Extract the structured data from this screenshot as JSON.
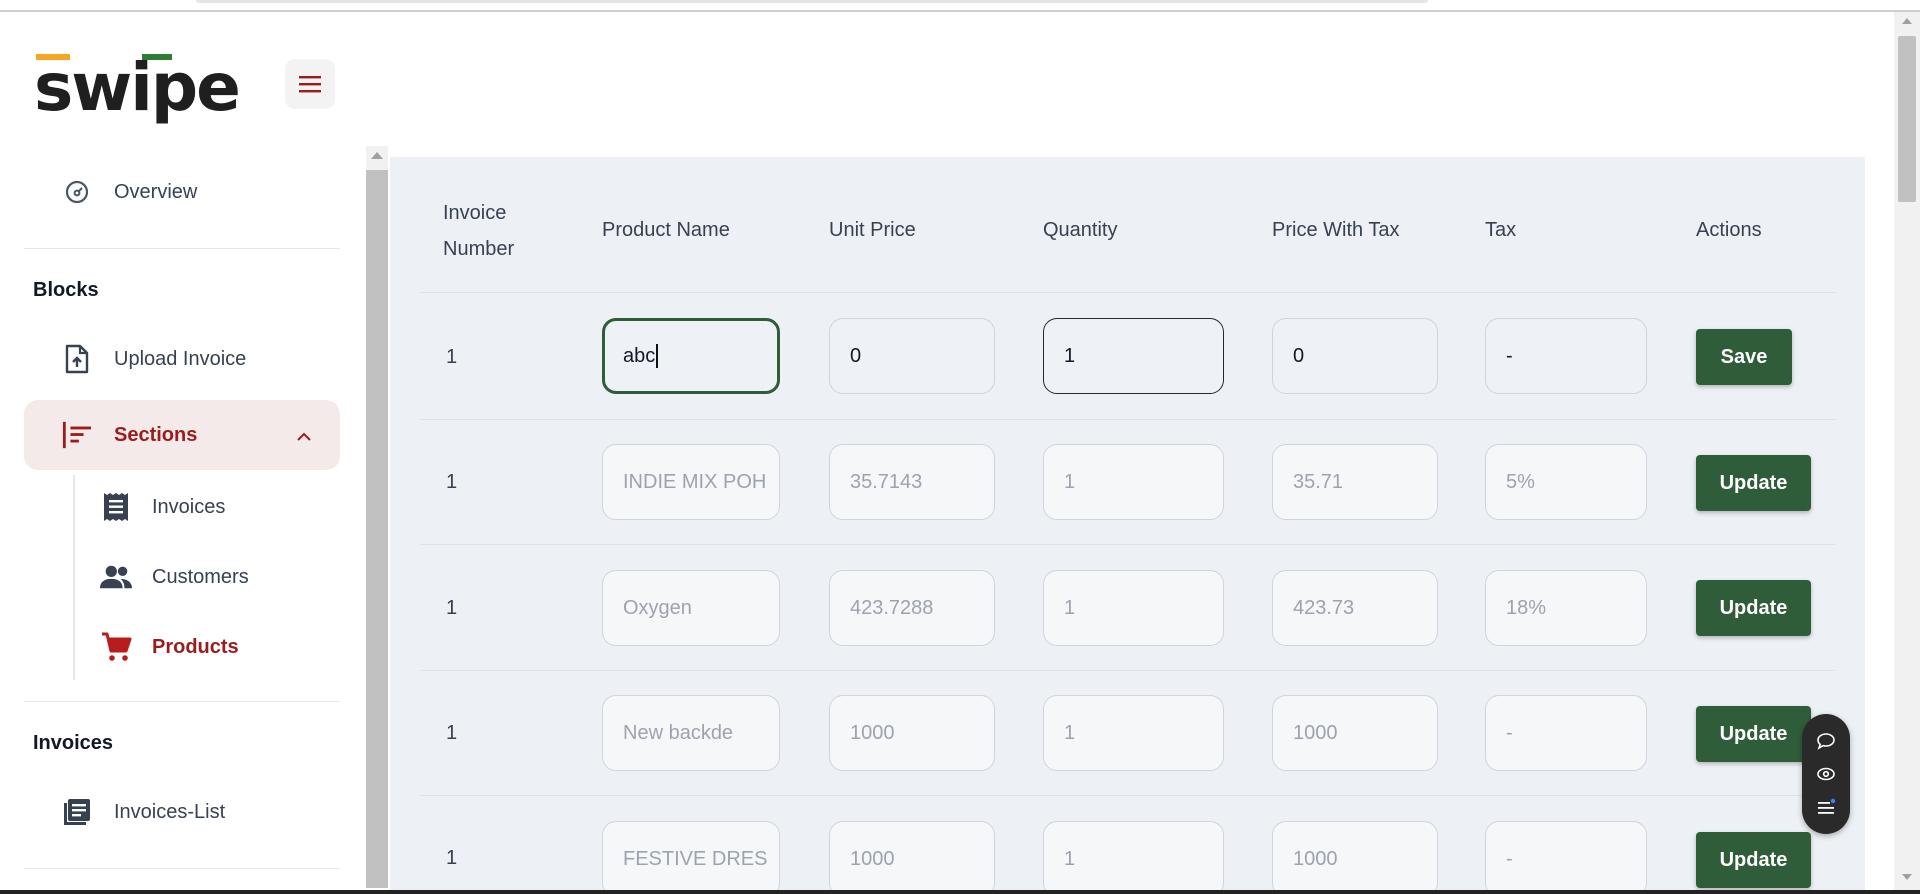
{
  "brand": {
    "logo_text": "swipe",
    "accent_orange": "#f5a623",
    "accent_green": "#2e7d32"
  },
  "sidebar": {
    "overview": "Overview",
    "blocks_heading": "Blocks",
    "upload_invoice": "Upload Invoice",
    "sections": "Sections",
    "sub_items": [
      "Invoices",
      "Customers",
      "Products"
    ],
    "invoices_heading": "Invoices",
    "invoices_list": "Invoices-List"
  },
  "table": {
    "headers": {
      "invoice_number_line1": "Invoice",
      "invoice_number_line2": "Number",
      "product_name": "Product Name",
      "unit_price": "Unit Price",
      "quantity": "Quantity",
      "price_with_tax": "Price With Tax",
      "tax": "Tax",
      "actions": "Actions"
    },
    "rows": [
      {
        "invoice": "1",
        "product": "abc",
        "unit_price": "0",
        "quantity": "1",
        "price_with_tax": "0",
        "tax": "-",
        "action": "Save"
      },
      {
        "invoice": "1",
        "product": "INDIE MIX POH",
        "unit_price": "35.7143",
        "quantity": "1",
        "price_with_tax": "35.71",
        "tax": "5%",
        "action": "Update"
      },
      {
        "invoice": "1",
        "product": "Oxygen",
        "unit_price": "423.7288",
        "quantity": "1",
        "price_with_tax": "423.73",
        "tax": "18%",
        "action": "Update"
      },
      {
        "invoice": "1",
        "product": "New backde",
        "unit_price": "1000",
        "quantity": "1",
        "price_with_tax": "1000",
        "tax": "-",
        "action": "Update"
      },
      {
        "invoice": "1",
        "product": "FESTIVE DRES",
        "unit_price": "1000",
        "quantity": "1",
        "price_with_tax": "1000",
        "tax": "-",
        "action": "Update"
      }
    ]
  },
  "colors": {
    "primary_red": "#9b1c1c",
    "button_green": "#2f5d3a"
  }
}
